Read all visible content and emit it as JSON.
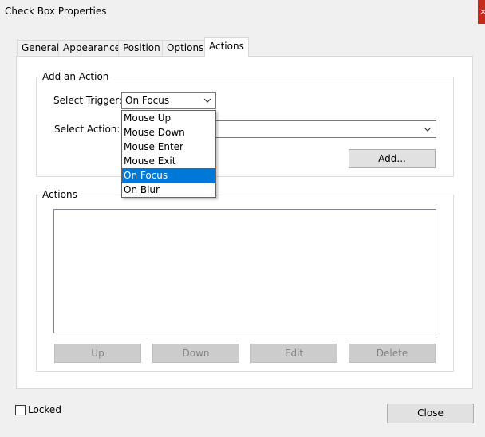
{
  "window": {
    "title": "Check Box Properties",
    "close_glyph": "×"
  },
  "tabs": [
    {
      "label": "General"
    },
    {
      "label": "Appearance"
    },
    {
      "label": "Position"
    },
    {
      "label": "Options"
    },
    {
      "label": "Actions",
      "active": true
    }
  ],
  "add_action": {
    "legend": "Add an Action",
    "trigger_label": "Select Trigger:",
    "trigger_value": "On Focus",
    "action_label": "Select Action:",
    "action_value": "",
    "add_button": "Add..."
  },
  "trigger_options": [
    "Mouse Up",
    "Mouse Down",
    "Mouse Enter",
    "Mouse Exit",
    "On Focus",
    "On Blur"
  ],
  "selected_trigger_index": 4,
  "actions_group": {
    "legend": "Actions",
    "buttons": {
      "up": "Up",
      "down": "Down",
      "edit": "Edit",
      "delete": "Delete"
    }
  },
  "footer": {
    "locked_label": "Locked",
    "locked_checked": false,
    "close_button": "Close"
  },
  "colors": {
    "selection": "#0078d7",
    "title_close": "#c42b1c"
  }
}
